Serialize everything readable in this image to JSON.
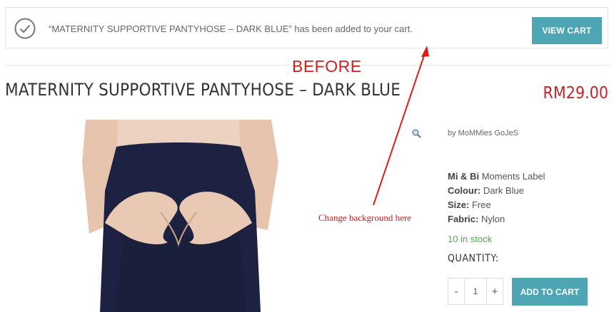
{
  "notice": {
    "message": "“MATERNITY SUPPORTIVE PANTYHOSE – DARK BLUE” has been added to your cart.",
    "view_cart_label": "VIEW CART"
  },
  "product": {
    "title": "MATERNITY SUPPORTIVE PANTYHOSE – DARK BLUE",
    "price": "RM29.00",
    "by_line": "by MoMMies GoJeS",
    "details": [
      {
        "label": "Mi & Bi",
        "value": "Moments Label"
      },
      {
        "label": "Colour:",
        "value": "Dark Blue"
      },
      {
        "label": "Size:",
        "value": "Free"
      },
      {
        "label": "Fabric:",
        "value": "Nylon"
      }
    ],
    "stock": "10 in stock",
    "quantity_label": "QUANTITY:",
    "quantity_value": "1",
    "minus": "-",
    "plus": "+",
    "add_to_cart_label": "ADD TO CART"
  },
  "annotations": {
    "before": "BEFORE",
    "change_note": "Change background here",
    "color": "#d31e1e"
  },
  "colors": {
    "accent": "#4ea6b4",
    "price": "#c92227",
    "stock": "#4fa94f"
  },
  "icons": {
    "notice": "check-circle-icon",
    "zoom": "magnifier-icon"
  }
}
